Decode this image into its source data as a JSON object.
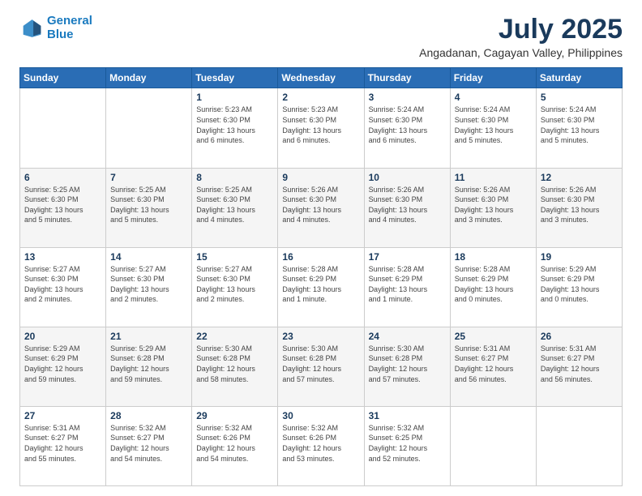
{
  "logo": {
    "line1": "General",
    "line2": "Blue"
  },
  "header": {
    "title": "July 2025",
    "subtitle": "Angadanan, Cagayan Valley, Philippines"
  },
  "days_of_week": [
    "Sunday",
    "Monday",
    "Tuesday",
    "Wednesday",
    "Thursday",
    "Friday",
    "Saturday"
  ],
  "weeks": [
    [
      {
        "day": "",
        "info": ""
      },
      {
        "day": "",
        "info": ""
      },
      {
        "day": "1",
        "info": "Sunrise: 5:23 AM\nSunset: 6:30 PM\nDaylight: 13 hours\nand 6 minutes."
      },
      {
        "day": "2",
        "info": "Sunrise: 5:23 AM\nSunset: 6:30 PM\nDaylight: 13 hours\nand 6 minutes."
      },
      {
        "day": "3",
        "info": "Sunrise: 5:24 AM\nSunset: 6:30 PM\nDaylight: 13 hours\nand 6 minutes."
      },
      {
        "day": "4",
        "info": "Sunrise: 5:24 AM\nSunset: 6:30 PM\nDaylight: 13 hours\nand 5 minutes."
      },
      {
        "day": "5",
        "info": "Sunrise: 5:24 AM\nSunset: 6:30 PM\nDaylight: 13 hours\nand 5 minutes."
      }
    ],
    [
      {
        "day": "6",
        "info": "Sunrise: 5:25 AM\nSunset: 6:30 PM\nDaylight: 13 hours\nand 5 minutes."
      },
      {
        "day": "7",
        "info": "Sunrise: 5:25 AM\nSunset: 6:30 PM\nDaylight: 13 hours\nand 5 minutes."
      },
      {
        "day": "8",
        "info": "Sunrise: 5:25 AM\nSunset: 6:30 PM\nDaylight: 13 hours\nand 4 minutes."
      },
      {
        "day": "9",
        "info": "Sunrise: 5:26 AM\nSunset: 6:30 PM\nDaylight: 13 hours\nand 4 minutes."
      },
      {
        "day": "10",
        "info": "Sunrise: 5:26 AM\nSunset: 6:30 PM\nDaylight: 13 hours\nand 4 minutes."
      },
      {
        "day": "11",
        "info": "Sunrise: 5:26 AM\nSunset: 6:30 PM\nDaylight: 13 hours\nand 3 minutes."
      },
      {
        "day": "12",
        "info": "Sunrise: 5:26 AM\nSunset: 6:30 PM\nDaylight: 13 hours\nand 3 minutes."
      }
    ],
    [
      {
        "day": "13",
        "info": "Sunrise: 5:27 AM\nSunset: 6:30 PM\nDaylight: 13 hours\nand 2 minutes."
      },
      {
        "day": "14",
        "info": "Sunrise: 5:27 AM\nSunset: 6:30 PM\nDaylight: 13 hours\nand 2 minutes."
      },
      {
        "day": "15",
        "info": "Sunrise: 5:27 AM\nSunset: 6:30 PM\nDaylight: 13 hours\nand 2 minutes."
      },
      {
        "day": "16",
        "info": "Sunrise: 5:28 AM\nSunset: 6:29 PM\nDaylight: 13 hours\nand 1 minute."
      },
      {
        "day": "17",
        "info": "Sunrise: 5:28 AM\nSunset: 6:29 PM\nDaylight: 13 hours\nand 1 minute."
      },
      {
        "day": "18",
        "info": "Sunrise: 5:28 AM\nSunset: 6:29 PM\nDaylight: 13 hours\nand 0 minutes."
      },
      {
        "day": "19",
        "info": "Sunrise: 5:29 AM\nSunset: 6:29 PM\nDaylight: 13 hours\nand 0 minutes."
      }
    ],
    [
      {
        "day": "20",
        "info": "Sunrise: 5:29 AM\nSunset: 6:29 PM\nDaylight: 12 hours\nand 59 minutes."
      },
      {
        "day": "21",
        "info": "Sunrise: 5:29 AM\nSunset: 6:28 PM\nDaylight: 12 hours\nand 59 minutes."
      },
      {
        "day": "22",
        "info": "Sunrise: 5:30 AM\nSunset: 6:28 PM\nDaylight: 12 hours\nand 58 minutes."
      },
      {
        "day": "23",
        "info": "Sunrise: 5:30 AM\nSunset: 6:28 PM\nDaylight: 12 hours\nand 57 minutes."
      },
      {
        "day": "24",
        "info": "Sunrise: 5:30 AM\nSunset: 6:28 PM\nDaylight: 12 hours\nand 57 minutes."
      },
      {
        "day": "25",
        "info": "Sunrise: 5:31 AM\nSunset: 6:27 PM\nDaylight: 12 hours\nand 56 minutes."
      },
      {
        "day": "26",
        "info": "Sunrise: 5:31 AM\nSunset: 6:27 PM\nDaylight: 12 hours\nand 56 minutes."
      }
    ],
    [
      {
        "day": "27",
        "info": "Sunrise: 5:31 AM\nSunset: 6:27 PM\nDaylight: 12 hours\nand 55 minutes."
      },
      {
        "day": "28",
        "info": "Sunrise: 5:32 AM\nSunset: 6:27 PM\nDaylight: 12 hours\nand 54 minutes."
      },
      {
        "day": "29",
        "info": "Sunrise: 5:32 AM\nSunset: 6:26 PM\nDaylight: 12 hours\nand 54 minutes."
      },
      {
        "day": "30",
        "info": "Sunrise: 5:32 AM\nSunset: 6:26 PM\nDaylight: 12 hours\nand 53 minutes."
      },
      {
        "day": "31",
        "info": "Sunrise: 5:32 AM\nSunset: 6:25 PM\nDaylight: 12 hours\nand 52 minutes."
      },
      {
        "day": "",
        "info": ""
      },
      {
        "day": "",
        "info": ""
      }
    ]
  ]
}
